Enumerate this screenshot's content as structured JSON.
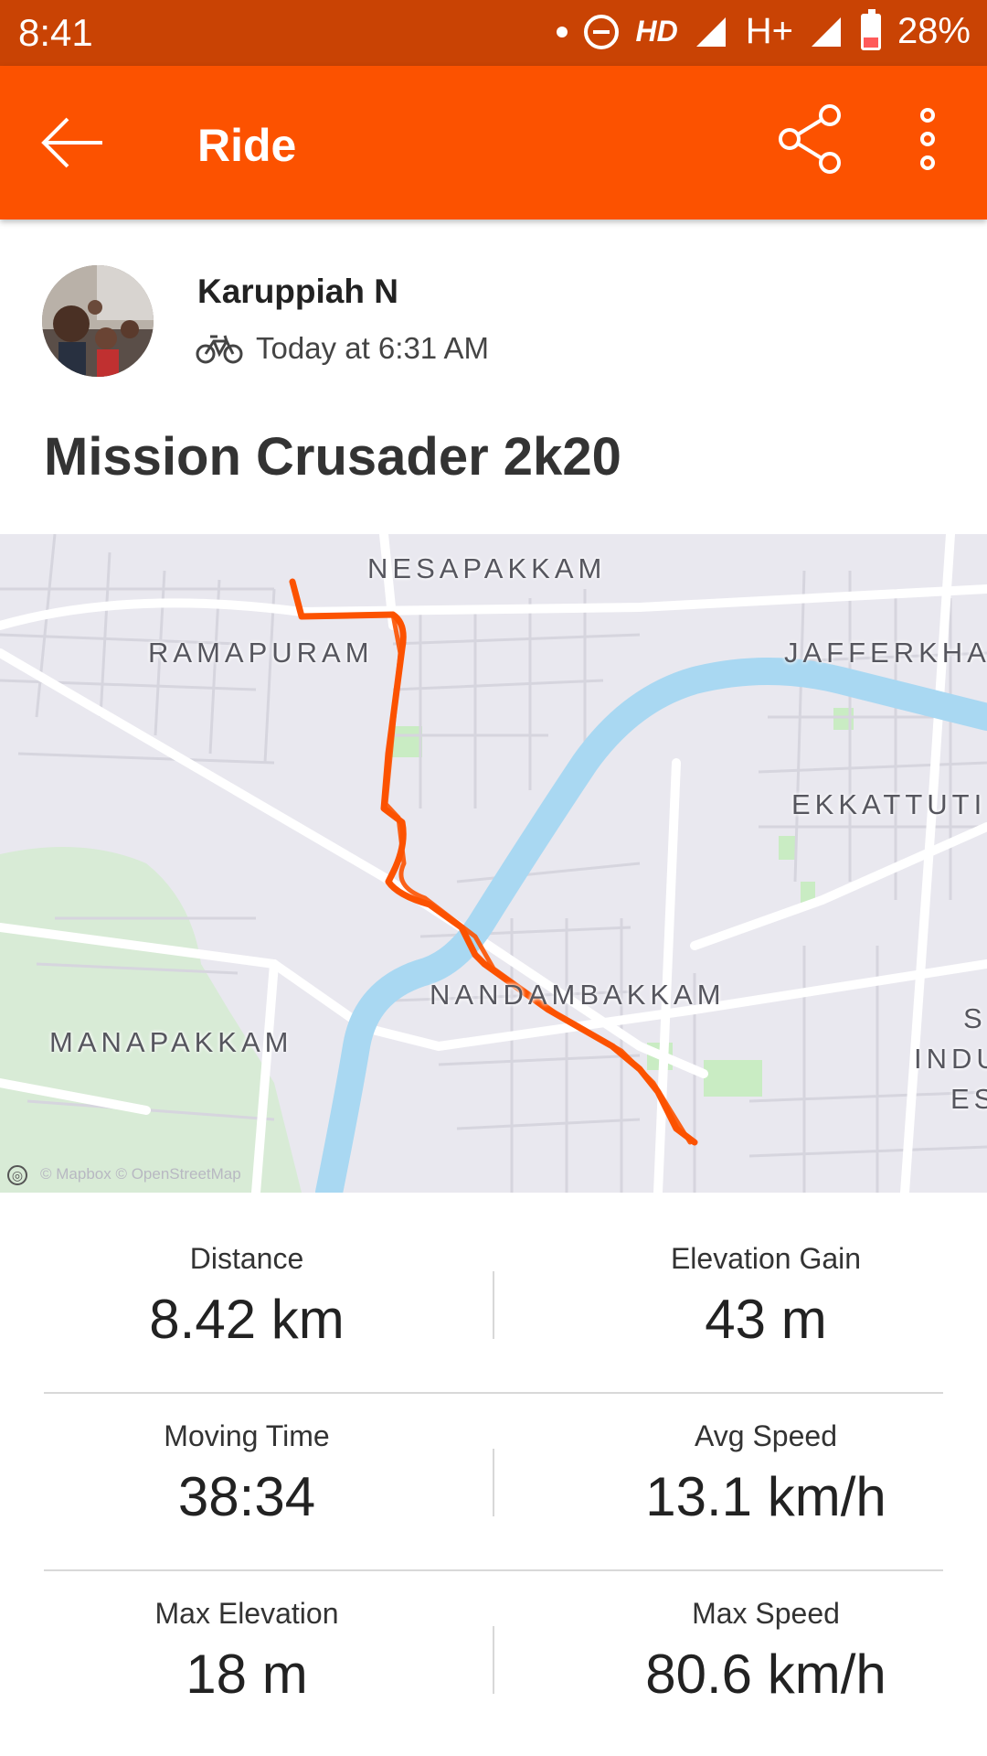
{
  "status_bar": {
    "time": "8:41",
    "network": "H+",
    "hd": "HD",
    "battery": "28%"
  },
  "app_bar": {
    "title": "Ride",
    "back_icon": "arrow-left-icon",
    "share_icon": "share-icon",
    "more_icon": "more-vertical-icon",
    "color": "#fc5200"
  },
  "athlete": {
    "name": "Karuppiah N",
    "activity_icon": "bike-icon",
    "time": "Today at 6:31 AM"
  },
  "activity": {
    "title": "Mission Crusader 2k20"
  },
  "map": {
    "labels": {
      "nesapakkam": "NESAPAKKAM",
      "ramapuram": "RAMAPURAM",
      "jafferkha": "JAFFERKHA",
      "ekkattut": "EKKATTUTI",
      "nandambakkam": "NANDAMBAKKAM",
      "manapakkam": "MANAPAKKAM",
      "indu_s": "S",
      "indu": "INDU",
      "indu_es": "ES"
    },
    "attribution": "© Mapbox © OpenStreetMap",
    "route_color": "#fc5200",
    "water_color": "#a9d8f2"
  },
  "stats": {
    "distance_label": "Distance",
    "distance_value": "8.42 km",
    "elevation_gain_label": "Elevation Gain",
    "elevation_gain_value": "43 m",
    "moving_time_label": "Moving Time",
    "moving_time_value": "38:34",
    "avg_speed_label": "Avg Speed",
    "avg_speed_value": "13.1 km/h",
    "max_elevation_label": "Max Elevation",
    "max_elevation_value": "18 m",
    "max_speed_label": "Max Speed",
    "max_speed_value": "80.6 km/h"
  }
}
